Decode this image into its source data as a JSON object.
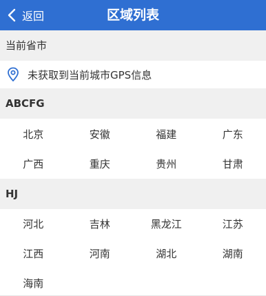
{
  "header": {
    "back_label": "返回",
    "title": "区域列表",
    "back_icon": "chevron-left-icon",
    "bg_color": "#2f6fd2"
  },
  "current": {
    "label": "当前省市",
    "gps_icon": "location-pin-icon",
    "gps_text": "未获取到当前城市GPS信息"
  },
  "sections": [
    {
      "letter": "ABCFG",
      "items": [
        "北京",
        "安徽",
        "福建",
        "广东",
        "广西",
        "重庆",
        "贵州",
        "甘肃"
      ]
    },
    {
      "letter": "HJ",
      "items": [
        "河北",
        "吉林",
        "黑龙江",
        "江苏",
        "江西",
        "河南",
        "湖北",
        "湖南",
        "海南"
      ]
    }
  ]
}
